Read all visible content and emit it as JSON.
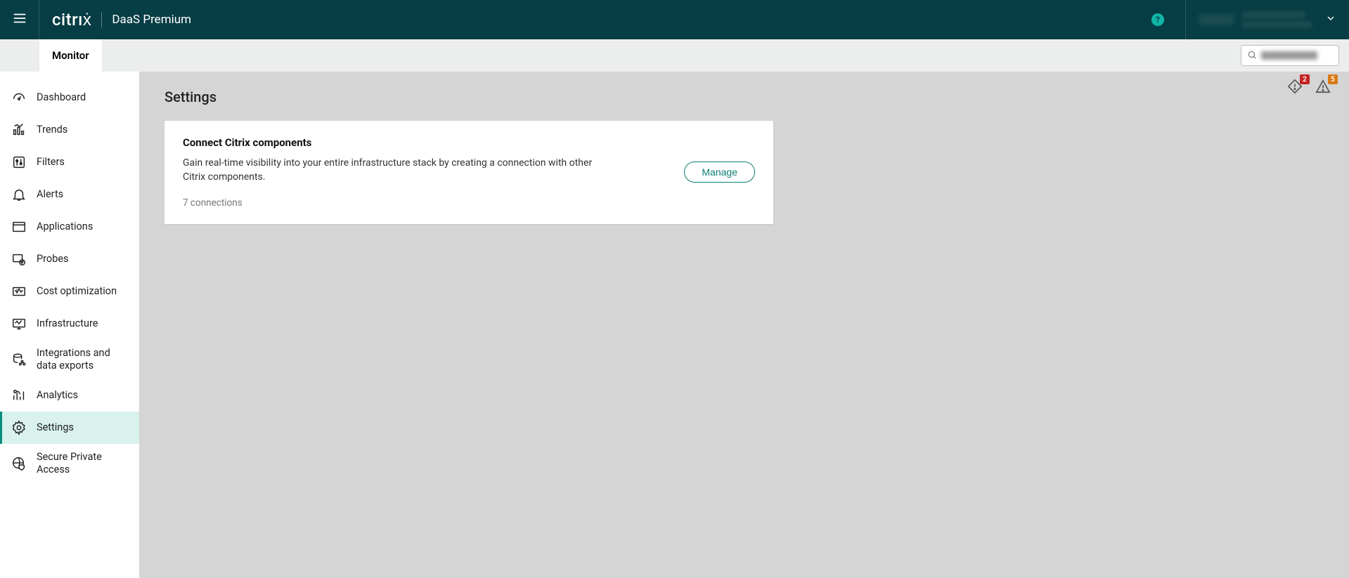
{
  "header": {
    "brand": "citrıẋ",
    "product": "DaaS Premium",
    "help": "?"
  },
  "sub_header": {
    "tab_monitor": "Monitor"
  },
  "sidebar": {
    "items": [
      {
        "label": "Dashboard"
      },
      {
        "label": "Trends"
      },
      {
        "label": "Filters"
      },
      {
        "label": "Alerts"
      },
      {
        "label": "Applications"
      },
      {
        "label": "Probes"
      },
      {
        "label": "Cost optimization"
      },
      {
        "label": "Infrastructure"
      },
      {
        "label": "Integrations and data exports"
      },
      {
        "label": "Analytics"
      },
      {
        "label": "Settings"
      },
      {
        "label": "Secure Private Access"
      }
    ]
  },
  "alerts_top": {
    "critical_count": "2",
    "warning_count": "5"
  },
  "page": {
    "title": "Settings"
  },
  "card": {
    "title": "Connect Citrix components",
    "description": "Gain real-time visibility into your entire infrastructure stack by creating a connection with other Citrix components.",
    "meta": "7 connections",
    "button": "Manage"
  }
}
